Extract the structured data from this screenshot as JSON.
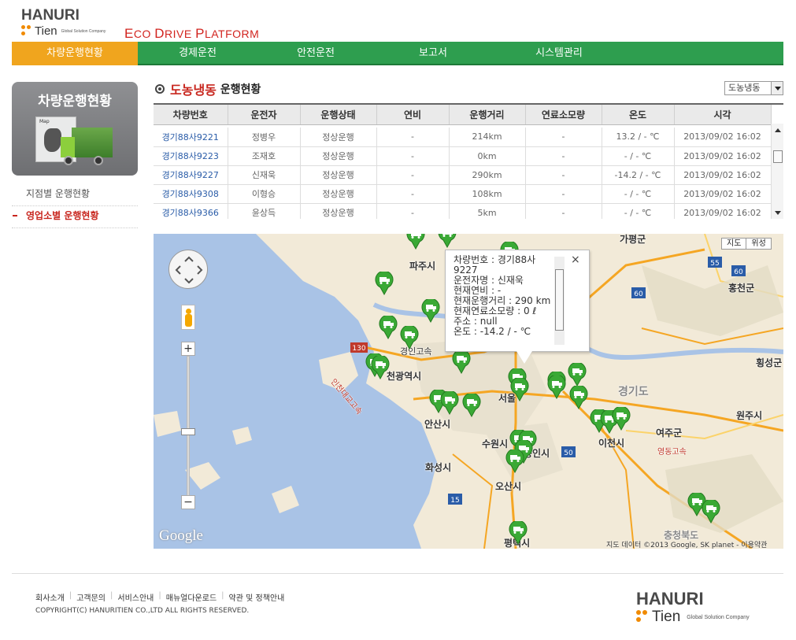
{
  "logo": {
    "main": "HANURI",
    "sub": "Tien",
    "tagline": "Global Solution Company"
  },
  "app_title": "Eco Drive Platform",
  "colors": {
    "nav_green": "#2e9e4f",
    "nav_active": "#f0a51e",
    "accent_red": "#c8261e",
    "link_blue": "#2a5ca8"
  },
  "nav": {
    "items": [
      {
        "label": "차량운행현황",
        "active": true
      },
      {
        "label": "경제운전"
      },
      {
        "label": "안전운전"
      },
      {
        "label": "보고서"
      },
      {
        "label": "시스템관리"
      }
    ]
  },
  "sidebar": {
    "banner_title": "차량운행현황",
    "banner_board_label": "Map",
    "menu": [
      {
        "label": "지점별 운행현황"
      },
      {
        "label": "영업소별 운행현황",
        "active": true
      }
    ]
  },
  "content": {
    "title_highlight": "도농냉동",
    "title_rest": "운행현황",
    "branch_select": {
      "value": "도농냉동"
    }
  },
  "table": {
    "headers": [
      "차량번호",
      "운전자",
      "운행상태",
      "연비",
      "운행거리",
      "연료소모량",
      "온도",
      "시각"
    ],
    "rows": [
      [
        "경기88사9221",
        "정병우",
        "정상운행",
        "-",
        "214km",
        "-",
        "13.2 / - ℃",
        "2013/09/02 16:02"
      ],
      [
        "경기88사9223",
        "조재호",
        "정상운행",
        "-",
        "0km",
        "-",
        "- / - ℃",
        "2013/09/02 16:02"
      ],
      [
        "경기88사9227",
        "신재욱",
        "정상운행",
        "-",
        "290km",
        "-",
        "-14.2 / - ℃",
        "2013/09/02 16:02"
      ],
      [
        "경기88사9308",
        "이형승",
        "정상운행",
        "-",
        "108km",
        "-",
        "- / - ℃",
        "2013/09/02 16:02"
      ],
      [
        "경기88사9366",
        "윤상득",
        "정상운행",
        "-",
        "5km",
        "-",
        "- / - ℃",
        "2013/09/02 16:02"
      ]
    ]
  },
  "map": {
    "type_buttons": [
      "지도",
      "위성"
    ],
    "labels": [
      "가평군",
      "파주시",
      "홍천군",
      "경인고속",
      "천광역시",
      "횡성군",
      "서울",
      "경기도",
      "원주시",
      "여주군",
      "안산시",
      "이천시",
      "영동고속",
      "화성시",
      "수원시",
      "용인시",
      "오산시",
      "평택시",
      "충청북도",
      "인천대교고속"
    ],
    "highway_shields": [
      "130",
      "60",
      "55",
      "50",
      "15"
    ],
    "attribution": "지도 데이터 ©2013 Google, SK planet - 이용약관",
    "google_logo": "Google",
    "zoom_in": "+",
    "zoom_out": "−",
    "info_window": {
      "lines": [
        "차량번호 : 경기88사9227",
        "운전자명 : 신재욱",
        "현재연비 : -",
        "현재운행거리 : 290 km",
        "현재연료소모량 : 0 ℓ",
        "주소 : null",
        "온도 : -14.2 / - ℃"
      ],
      "close": "×"
    }
  },
  "footer": {
    "links": [
      "회사소개",
      "고객문의",
      "서비스안내",
      "매뉴얼다운로드",
      "약관 및 정책안내"
    ],
    "copyright": "COPYRIGHT(C) HANURITIEN CO.,LTD ALL RIGHTS RESERVED.",
    "logo_main": "HANURI",
    "logo_sub": "Tien",
    "logo_tagline": "Global Solution Company"
  }
}
